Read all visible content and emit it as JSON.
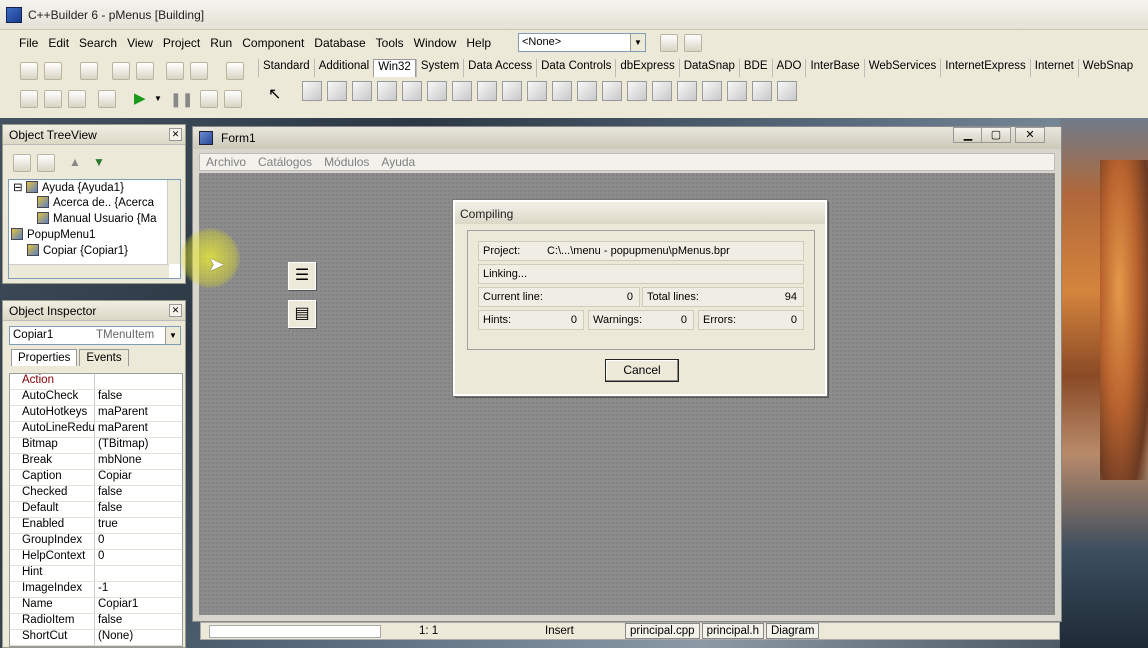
{
  "window": {
    "title": "C++Builder 6 - pMenus [Building]"
  },
  "menu": [
    "File",
    "Edit",
    "Search",
    "View",
    "Project",
    "Run",
    "Component",
    "Database",
    "Tools",
    "Window",
    "Help"
  ],
  "toolbar": {
    "combo_value": "<None>"
  },
  "palette_tabs": [
    "Standard",
    "Additional",
    "Win32",
    "System",
    "Data Access",
    "Data Controls",
    "dbExpress",
    "DataSnap",
    "BDE",
    "ADO",
    "InterBase",
    "WebServices",
    "InternetExpress",
    "Internet",
    "WebSnap"
  ],
  "palette_active": "Win32",
  "tree_view": {
    "title": "Object TreeView",
    "items": [
      "Ayuda {Ayuda1}",
      "Acerca de.. {Acerca",
      "Manual Usuario {Ma",
      "PopupMenu1",
      "Copiar {Copiar1}"
    ]
  },
  "inspector": {
    "title": "Object Inspector",
    "object_name": "Copiar1",
    "object_type": "TMenuItem",
    "tab_properties": "Properties",
    "tab_events": "Events",
    "rows": [
      {
        "name": "Action",
        "value": ""
      },
      {
        "name": "AutoCheck",
        "value": "false"
      },
      {
        "name": "AutoHotkeys",
        "value": "maParent"
      },
      {
        "name": "AutoLineReduc",
        "value": "maParent"
      },
      {
        "name": "Bitmap",
        "value": "(TBitmap)"
      },
      {
        "name": "Break",
        "value": "mbNone"
      },
      {
        "name": "Caption",
        "value": "Copiar"
      },
      {
        "name": "Checked",
        "value": "false"
      },
      {
        "name": "Default",
        "value": "false"
      },
      {
        "name": "Enabled",
        "value": "true"
      },
      {
        "name": "GroupIndex",
        "value": "0"
      },
      {
        "name": "HelpContext",
        "value": "0"
      },
      {
        "name": "Hint",
        "value": ""
      },
      {
        "name": "ImageIndex",
        "value": "-1"
      },
      {
        "name": "Name",
        "value": "Copiar1"
      },
      {
        "name": "RadioItem",
        "value": "false"
      },
      {
        "name": "ShortCut",
        "value": "(None)"
      }
    ]
  },
  "form": {
    "title": "Form1",
    "menu": [
      "Archivo",
      "Catálogos",
      "Módulos",
      "Ayuda"
    ]
  },
  "compiling": {
    "title": "Compiling",
    "project_label": "Project:",
    "project_value": "C:\\...\\menu - popupmenu\\pMenus.bpr",
    "status": "Linking...",
    "current_line_label": "Current line:",
    "current_line_value": "0",
    "total_lines_label": "Total lines:",
    "total_lines_value": "94",
    "hints_label": "Hints:",
    "hints_value": "0",
    "warnings_label": "Warnings:",
    "warnings_value": "0",
    "errors_label": "Errors:",
    "errors_value": "0",
    "cancel": "Cancel"
  },
  "statusbar": {
    "position": "1:   1",
    "mode": "Insert",
    "tabs": [
      "principal.cpp",
      "principal.h",
      "Diagram"
    ]
  }
}
